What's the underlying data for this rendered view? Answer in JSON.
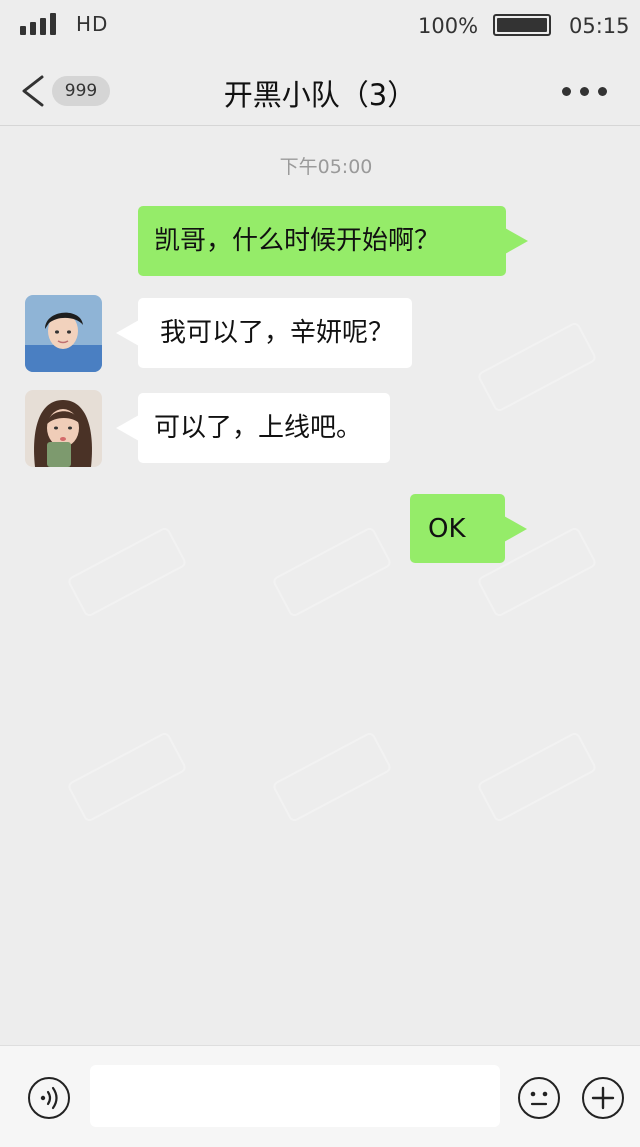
{
  "status_bar": {
    "network": "HD",
    "battery_text": "100%",
    "battery_level": 1.0,
    "time": "05:15"
  },
  "nav": {
    "unread_count": "999",
    "title": "开黑小队（3）"
  },
  "messages": {
    "timestamp": "下午05:00",
    "items": [
      {
        "side": "right",
        "text": "凯哥，什么时候开始啊？"
      },
      {
        "side": "left",
        "sender_avatar": "boy-avatar",
        "text": "我可以了，辛妍呢？"
      },
      {
        "side": "left",
        "sender_avatar": "girl-avatar",
        "text": "可以了，上线吧。"
      },
      {
        "side": "right",
        "text": "OK"
      }
    ]
  },
  "input_bar": {
    "placeholder": ""
  },
  "icons": {
    "back": "chevron-left-icon",
    "more": "more-dots-icon",
    "voice": "voice-icon",
    "emoji": "emoji-icon",
    "plus": "plus-icon"
  },
  "colors": {
    "background": "#ededed",
    "own_bubble": "#95ec69",
    "other_bubble": "#ffffff",
    "input_bar": "#f6f6f6"
  }
}
